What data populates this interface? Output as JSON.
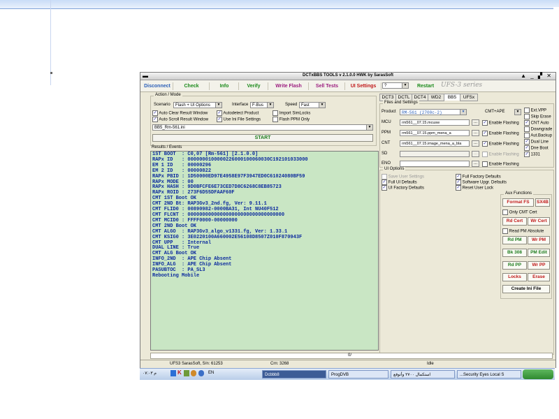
{
  "app": {
    "title": "DCTxBBS TOOLS v 2.1.0.0 HWK by SarasSoft",
    "window_controls": "▲ _ ▞ ✕"
  },
  "menu": {
    "disconnect": "Disconnect",
    "check": "Check",
    "info": "Info",
    "verify": "Verify",
    "write_flash": "Write Flash",
    "sell_tests": "Sell Tests",
    "ui_settings": "UI Settings",
    "help": "?",
    "restart": "Restart",
    "brand": "UFS-3  series"
  },
  "action": {
    "group_label": "Action / Mode",
    "scenario_label": "Scenario",
    "scenario_value": "Flash + UI Options",
    "interface_label": "Interface",
    "interface_value": "F-Bus",
    "speed_label": "Speed",
    "speed_value": "Fast",
    "auto_clear": "Auto Clear Result Window",
    "autodetect": "Autodetect Product",
    "import_simlocks": "Import SimLocks",
    "auto_scroll": "Auto Scroll Result Window",
    "use_ini": "Use Ini File Settings",
    "flash_ppm": "Flash PPM Only",
    "ini_file": "BB5_Rm-561.ini",
    "start": "START"
  },
  "results": {
    "label": "Results / Events",
    "lines": [
      "1ST BOOT  : C0,07 [Rm-561] [2.1.0.0]",
      "RAPx ID   : 0000000100000226000100060030C192101033000",
      "EM 1 ID   : 00000296",
      "EM 2 ID   : 00000822",
      "RAPx PBID : 1D50000ED97E4958E97F3947ED0C61024080BF59",
      "RAPx MODE : 00",
      "RAPx HASH : 9D0BFCFE6E73CED7D8C6268C8EB85723",
      "RAPx ROID : 273F6D55DFAAF60F",
      "CMT 1ST Boot OK",
      "CMT 2ND Bt: RAP3Gv3_2nd.fg, Ver: 9.11.1",
      "CMT FLID0 : 00890982-0000BA31, Int NU40F512",
      "CMT FLCNT : 000000000000000000000000000000000",
      "CMT MCID0 : FFFF0000-00000000",
      "CMT 2ND Boot OK",
      "CMT ALGO  : RAP3Gv3_algo_v1331.fg, Ver: 1.33.1",
      "CMT KSIG0 : 3E0220100A660002E56108D8507Z010F870943F",
      "CMT UPP   : Internal",
      "DUAL LINE : True",
      "CMT ALG Boot OK",
      "INFO_2ND  : APE Chip Absent",
      "INFO_ALG  : APE Chip Absent",
      "PASUBTOC  : PA_SL3",
      "Rebooting Mobile"
    ]
  },
  "tabs": [
    "DCT3",
    "DCTL",
    "DCT4",
    "WD2",
    "BB5",
    "UFSx"
  ],
  "files": {
    "group_label": "Files and Settings",
    "product_label": "Product",
    "product_value": "RM-561 (2700c-2)",
    "cmt_ape": "CMT+APE",
    "mcu_label": "MCU",
    "mcu_value": "rm561__07.15.mcusw",
    "ppm_label": "PPM",
    "ppm_value": "rm561__07.15.ppm_mena_a",
    "cnt_label": "CNT",
    "cnt_value": "rm561__07.15.image_mena_a_bla",
    "sd_label": "SD",
    "eno_label": "ENO",
    "enable_flashing": "Enable Flashing",
    "dots": "...",
    "opts": {
      "ext_vpp": "Ext.VPP",
      "skip_erase": "Skip Erase",
      "cnt_auto": "CNT Auto",
      "downgrade": "Downgrade",
      "aut_backup": "Aut.Backup",
      "dual_line": "Dual Line",
      "dne_boot": "Dne Boot",
      "v1331": "1331"
    }
  },
  "ui_options": {
    "group_label": "UI Options",
    "save_user": "Save User Settings",
    "full_ui": "Full UI Defaults",
    "ui_factory": "UI Factory Defaults",
    "full_factory": "Full Factory Defaults",
    "software_upgr": "Software Upgr. Defaults",
    "reset_user_lock": "Reset User Lock"
  },
  "aux": {
    "label": "Aux Functions",
    "format_fs": "Format FS",
    "sx4b": "SX4B",
    "only_cmt_cert": "Only CMT Cert",
    "rd_cert": "Rd Cert",
    "wr_cert": "Wr Cert",
    "read_pm_absolute": "Read PM Absolute",
    "rd_pm": "Rd PM",
    "wr_pm": "Wr PM",
    "bk_308": "Bk 308",
    "pm_edit": "PM Edit",
    "rd_pp": "Rd PP",
    "wr_pp": "Wr PP",
    "locks": "Locks",
    "erase": "Erase",
    "create_ini": "Create Ini File"
  },
  "progress": {
    "text": "0/"
  },
  "status": {
    "serial": "UFS3 SarasSoft, S/n: 61253",
    "crn": "Crn: 3268",
    "state": "Idle"
  },
  "taskbar": {
    "clock": "۰۷:۰۳ م",
    "lang": "EN",
    "item1": "Dcbbb8",
    "item2": "ProgDVB",
    "item3": "استكمال ٢٧٠٠ وأتوقع",
    "item4": "...Security Eyes Local S"
  },
  "colors": {
    "results_bg": "#c9e6c4",
    "results_text": "#0b2a9e",
    "menu_green": "#1b8a1b",
    "menu_blue": "#2b5fb8",
    "menu_magenta": "#9b1b7e",
    "menu_red": "#c01818",
    "aux_red": "#c01818",
    "aux_green": "#1b7a1b"
  }
}
